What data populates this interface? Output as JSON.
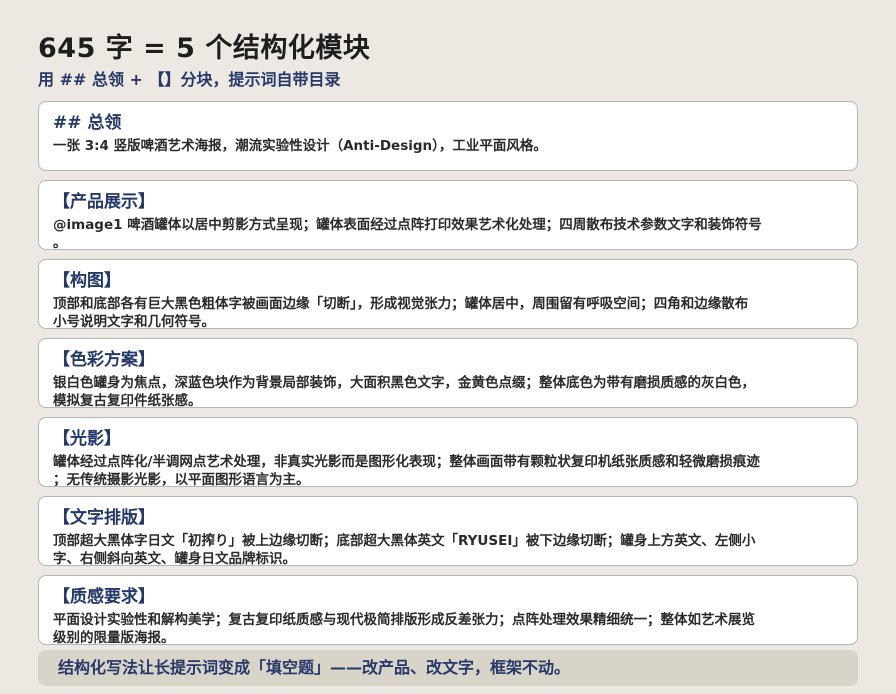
{
  "header": {
    "title": "645 字 = 5 个结构化模块",
    "subtitle": "用 ## 总领 + 【】分块，提示词自带目录"
  },
  "cards": [
    {
      "heading": "## 总领",
      "lines": [
        "一张 3:4 竖版啤酒艺术海报，潮流实验性设计（Anti-Design），工业平面风格。"
      ]
    },
    {
      "heading": "【产品展示】",
      "lines": [
        "@image1 啤酒罐体以居中剪影方式呈现；罐体表面经过点阵打印效果艺术化处理；四周散布技术参数文字和装饰符号",
        "。"
      ]
    },
    {
      "heading": "【构图】",
      "lines": [
        "顶部和底部各有巨大黑色粗体字被画面边缘「切断」，形成视觉张力；罐体居中，周围留有呼吸空间；四角和边缘散布",
        "小号说明文字和几何符号。"
      ]
    },
    {
      "heading": "【色彩方案】",
      "lines": [
        "银白色罐身为焦点，深蓝色块作为背景局部装饰，大面积黑色文字，金黄色点缀；整体底色为带有磨损质感的灰白色，",
        "模拟复古复印件纸张感。"
      ]
    },
    {
      "heading": "【光影】",
      "lines": [
        "罐体经过点阵化/半调网点艺术处理，非真实光影而是图形化表现；整体画面带有颗粒状复印机纸张质感和轻微磨损痕迹",
        "；无传统摄影光影，以平面图形语言为主。"
      ]
    },
    {
      "heading": "【文字排版】",
      "lines": [
        "顶部超大黑体字日文「初搾り」被上边缘切断；底部超大黑体英文「RYUSEI」被下边缘切断；罐身上方英文、左侧小",
        "字、右侧斜向英文、罐身日文品牌标识。"
      ]
    },
    {
      "heading": "【质感要求】",
      "lines": [
        "平面设计实验性和解构美学；复古复印纸质感与现代极简排版形成反差张力；点阵处理效果精细统一；整体如艺术展览",
        "级别的限量版海报。"
      ]
    }
  ],
  "footer": {
    "text": "结构化写法让长提示词变成「填空题」——改产品、改文字，框架不动。"
  },
  "colors": {
    "background": "#ede9e2",
    "accent_navy": "#24396a",
    "card_background": "#ffffff",
    "footer_background": "#d8d4c8"
  }
}
